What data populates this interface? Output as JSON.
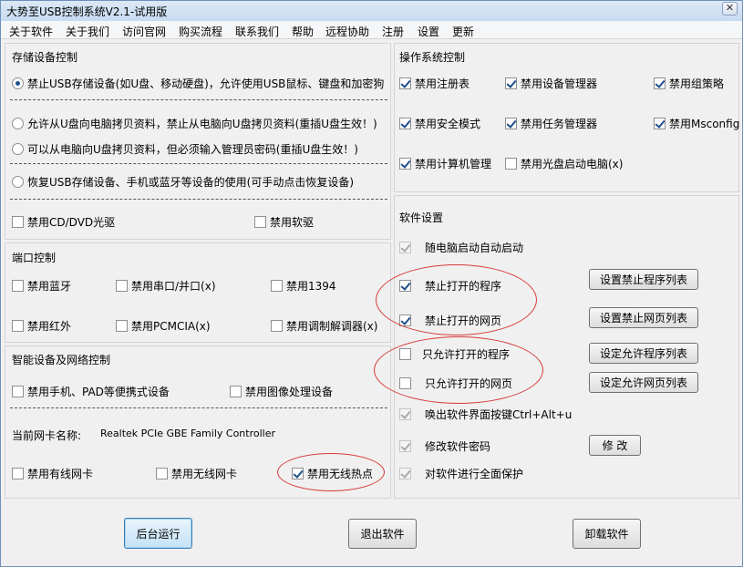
{
  "window": {
    "title": "大势至USB控制系统V2.1-试用版",
    "close": "✕"
  },
  "menu": [
    "关于软件",
    "关于我们",
    "访问官网",
    "购买流程",
    "联系我们",
    "帮助",
    "远程协助",
    "注册",
    "设置",
    "更新"
  ],
  "storage": {
    "title": "存储设备控制",
    "options": [
      {
        "label": "禁止USB存储设备(如U盘、移动硬盘)，允许使用USB鼠标、键盘和加密狗",
        "selected": true
      },
      {
        "label": "允许从U盘向电脑拷贝资料，禁止从电脑向U盘拷贝资料(重插U盘生效！)",
        "selected": false
      },
      {
        "label": "可以从电脑向U盘拷贝资料，但必须输入管理员密码(重插U盘生效！)",
        "selected": false
      },
      {
        "label": "恢复USB存储设备、手机或蓝牙等设备的使用(可手动点击恢复设备)",
        "selected": false
      }
    ],
    "cd_label": "禁用CD/DVD光驱",
    "floppy_label": "禁用软驱"
  },
  "port": {
    "title": "端口控制",
    "items": [
      "禁用蓝牙",
      "禁用串口/并口(x)",
      "禁用1394",
      "禁用红外",
      "禁用PCMCIA(x)",
      "禁用调制解调器(x)"
    ]
  },
  "network": {
    "title": "智能设备及网络控制",
    "mobile_label": "禁用手机、PAD等便携式设备",
    "imaging_label": "禁用图像处理设备",
    "nic_label": "当前网卡名称:",
    "nic_value": "Realtek PCIe GBE Family Controller",
    "wired_label": "禁用有线网卡",
    "wireless_label": "禁用无线网卡",
    "hotspot_label": "禁用无线热点"
  },
  "os": {
    "title": "操作系统控制",
    "items": [
      "禁用注册表",
      "禁用设备管理器",
      "禁用组策略",
      "禁用安全模式",
      "禁用任务管理器",
      "禁用Msconfig",
      "禁用计算机管理",
      "禁用光盘启动电脑(x)"
    ]
  },
  "software": {
    "title": "软件设置",
    "autostart": "随电脑启动自动启动",
    "block_programs": "禁止打开的程序",
    "block_programs_btn": "设置禁止程序列表",
    "block_web": "禁止打开的网页",
    "block_web_btn": "设置禁止网页列表",
    "allow_programs": "只允许打开的程序",
    "allow_programs_btn": "设定允许程序列表",
    "allow_web": "只允许打开的网页",
    "allow_web_btn": "设定允许网页列表",
    "hotkey": "唤出软件界面按键Ctrl+Alt+u",
    "password": "修改软件密码",
    "password_btn": "修 改",
    "protect": "对软件进行全面保护"
  },
  "footer": {
    "run_bg": "后台运行",
    "exit": "退出软件",
    "uninstall": "卸载软件"
  },
  "colors": {
    "annotation": "#d63a3a",
    "check": "#1d4f8a"
  }
}
